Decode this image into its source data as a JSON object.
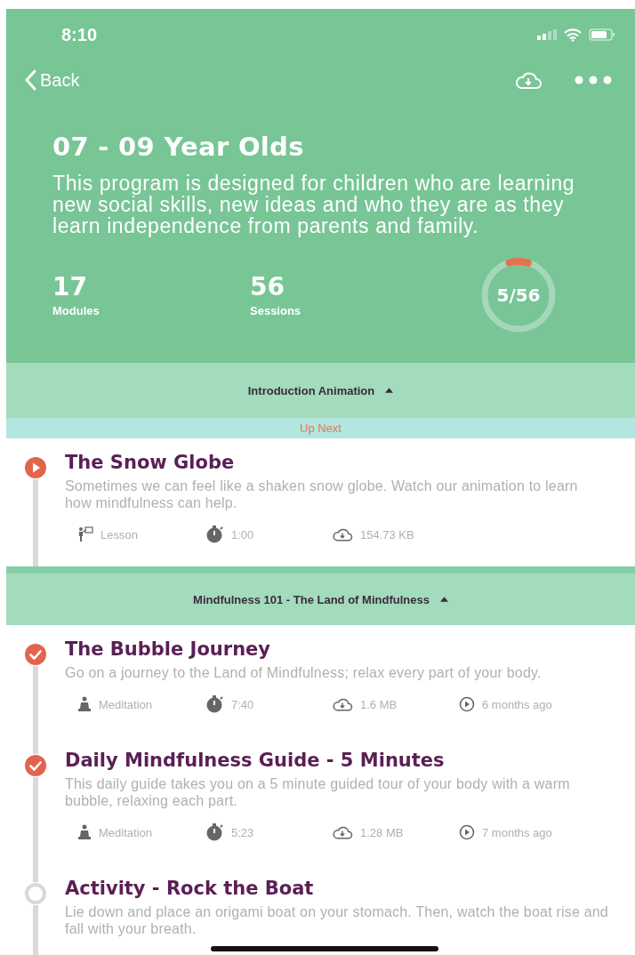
{
  "status_bar": {
    "time": "8:10"
  },
  "nav": {
    "back": "Back"
  },
  "program": {
    "title": "07 - 09 Year Olds",
    "description": "This program is designed for children who are learning new social skills, new ideas and who they are as they learn independence from parents and family."
  },
  "stats": [
    {
      "value": "17",
      "label": "Modules"
    },
    {
      "value": "56",
      "label": "Sessions"
    }
  ],
  "progress": {
    "text": "5/56",
    "level": 0.09
  },
  "sections": [
    {
      "title": "Introduction Animation",
      "expanded": true,
      "banner": "Up Next",
      "sessions": [
        {
          "kind": "current",
          "title": "The Snow Globe",
          "description": "Sometimes we can feel like a shaken snow globe. Watch our animation to learn how mindfulness can help.",
          "meta": [
            {
              "kind": "lesson",
              "text": "Lesson"
            },
            {
              "kind": "duration",
              "text": "1:00"
            },
            {
              "kind": "size",
              "text": "154.73 KB"
            }
          ]
        }
      ]
    },
    {
      "title": "Mindfulness 101 - The Land of Mindfulness",
      "expanded": true,
      "sessions": [
        {
          "kind": "done",
          "title": "The Bubble Journey",
          "description": "Go on a journey to the Land of Mindfulness; relax every part of your body.",
          "meta": [
            {
              "kind": "meditation",
              "text": "Meditation"
            },
            {
              "kind": "duration",
              "text": "7:40"
            },
            {
              "kind": "size",
              "text": "1.6 MB"
            },
            {
              "kind": "played",
              "text": "6 months ago"
            }
          ]
        },
        {
          "kind": "done",
          "title": "Daily Mindfulness Guide - 5 Minutes",
          "description": "This daily guide takes you on a 5 minute guided tour of your body with a warm bubble, relaxing each part.",
          "meta": [
            {
              "kind": "meditation",
              "text": "Meditation"
            },
            {
              "kind": "duration",
              "text": "5:23"
            },
            {
              "kind": "size",
              "text": "1.28 MB"
            },
            {
              "kind": "played",
              "text": "7 months ago"
            }
          ]
        },
        {
          "kind": "todo",
          "title": "Activity - Rock the Boat",
          "description": "Lie down and place an origami boat on your stomach. Then, watch the boat rise and fall with your breath."
        }
      ]
    }
  ]
}
